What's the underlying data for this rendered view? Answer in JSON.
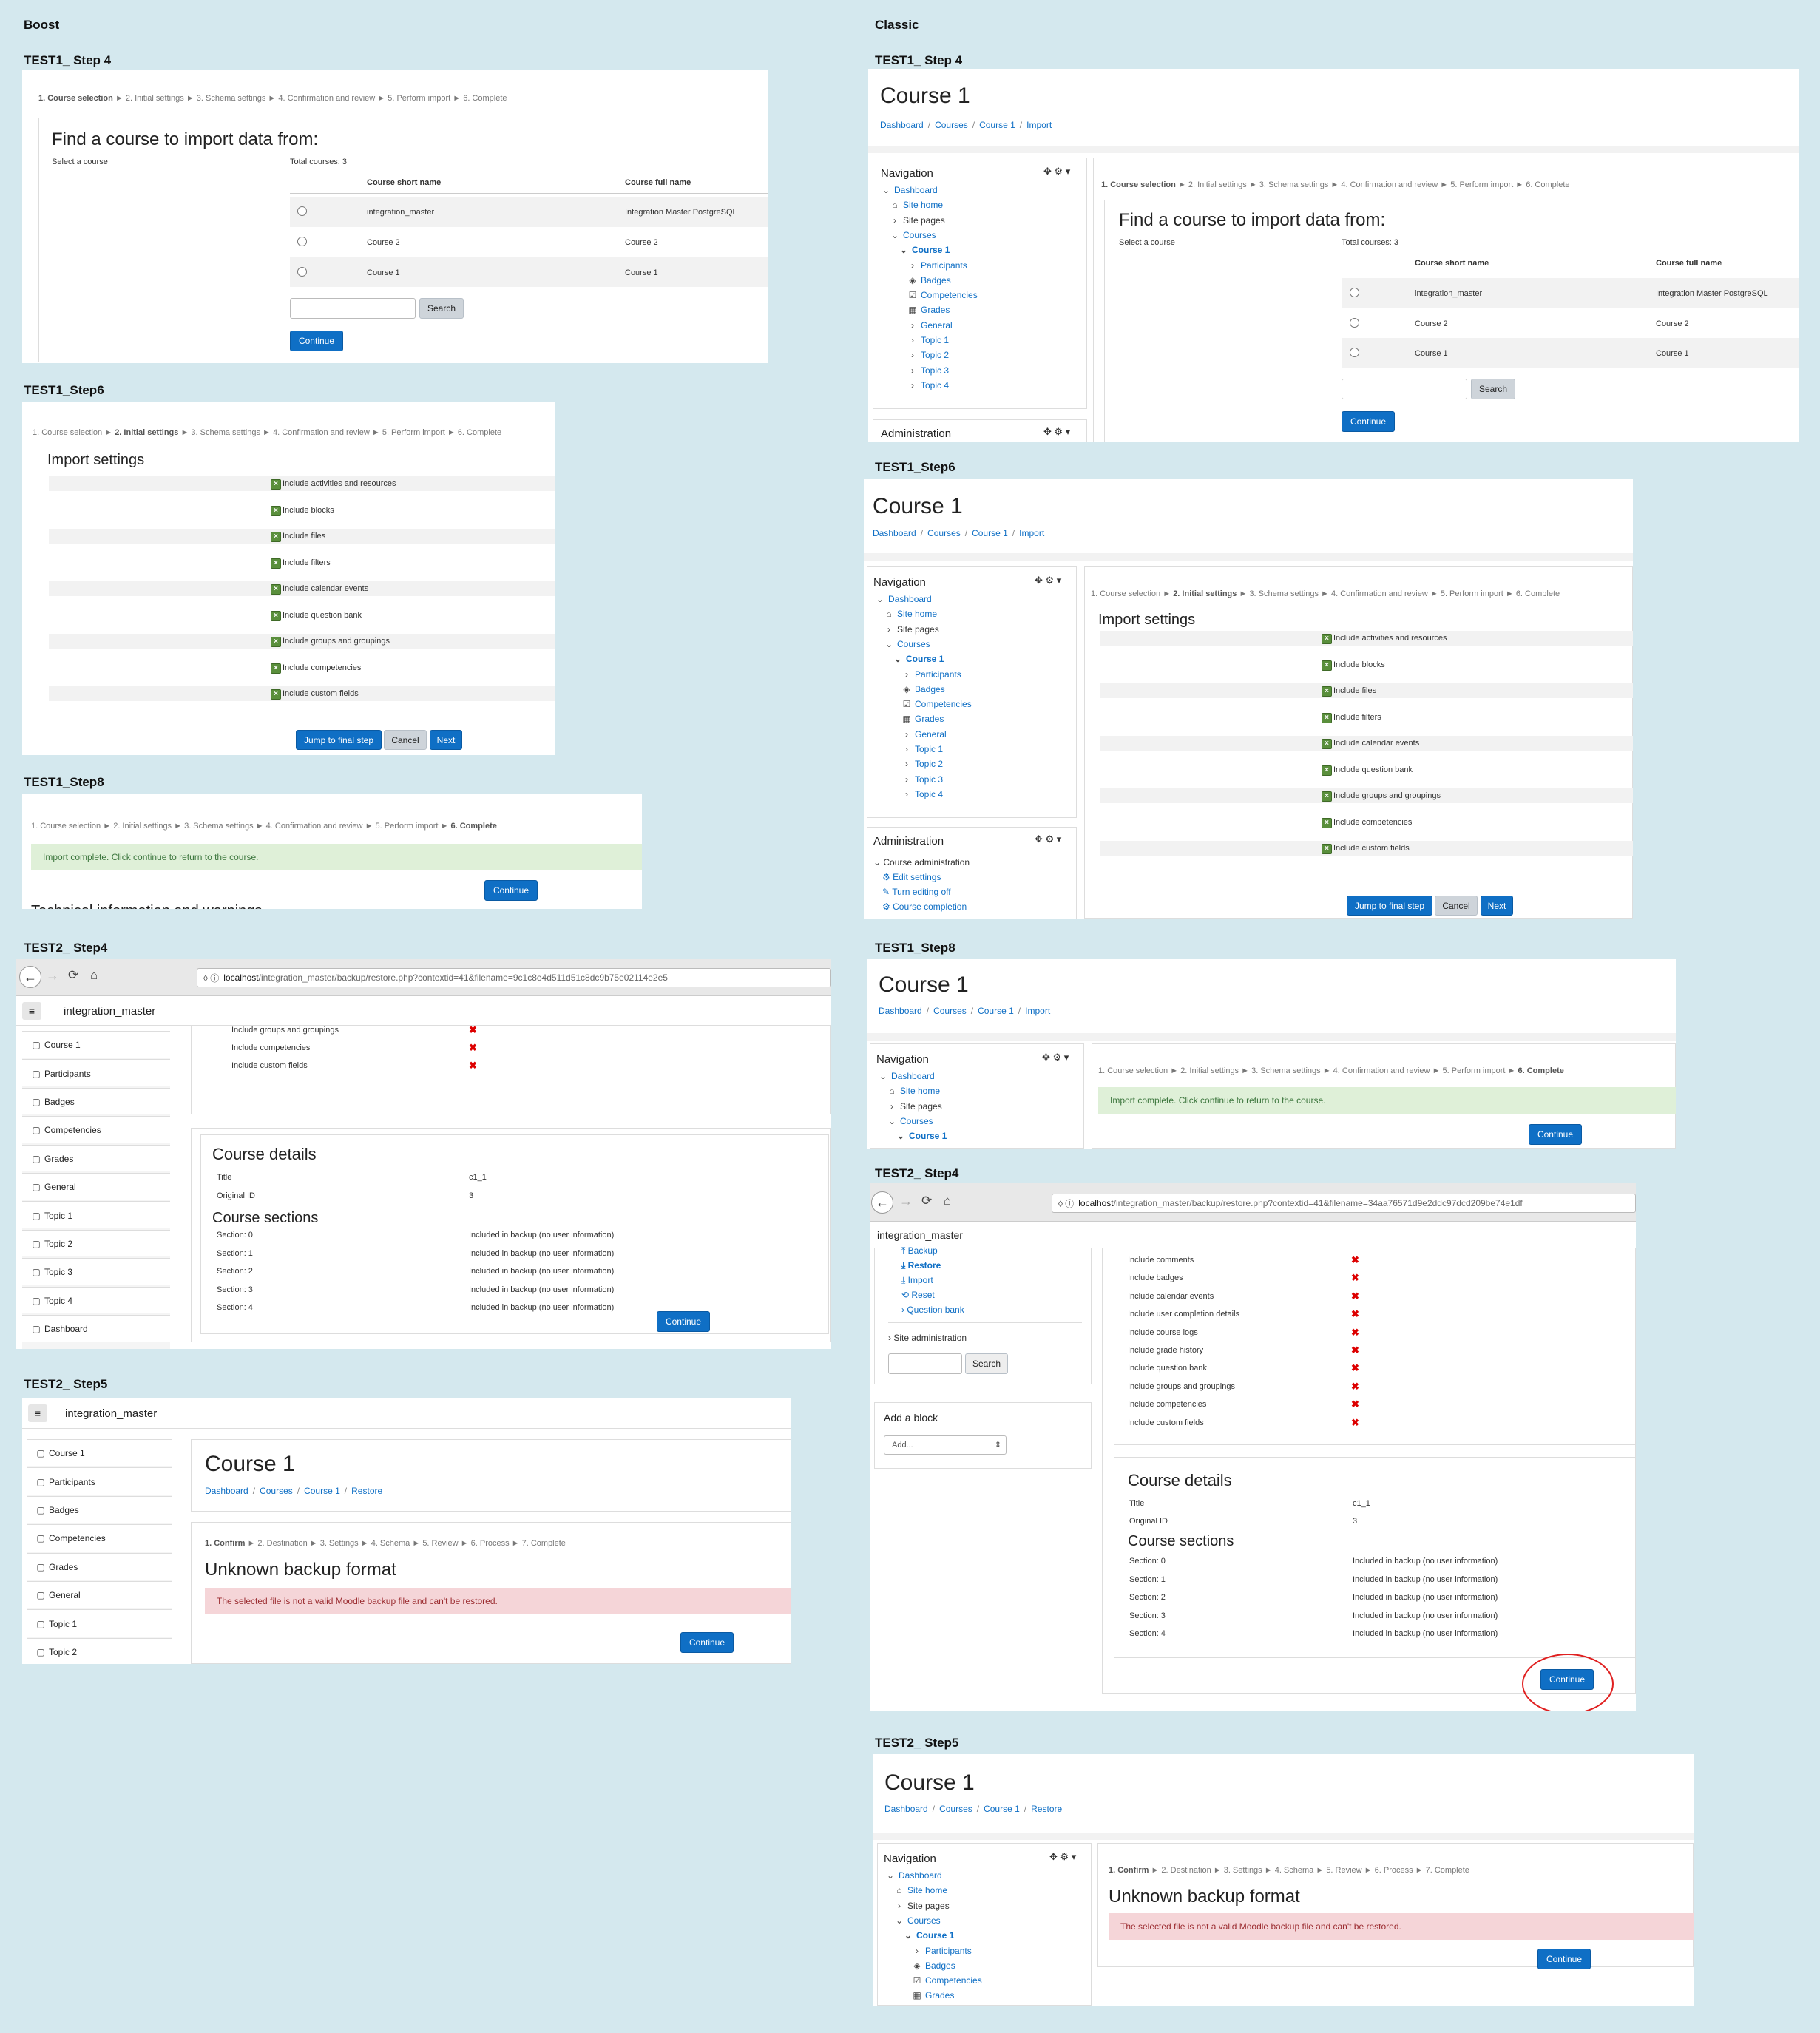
{
  "headers": {
    "boost": "Boost",
    "classic": "Classic"
  },
  "steps_import": {
    "s1": "1. Course selection",
    "s2": "2. Initial settings",
    "s3": "3. Schema settings",
    "s4": "4. Confirmation and review",
    "s5": "5. Perform import",
    "s6": "6. Complete",
    "arrow": "►"
  },
  "steps_restore": {
    "s1": "1. Confirm",
    "s2": "2. Destination",
    "s3": "3. Settings",
    "s4": "4. Schema",
    "s5": "5. Review",
    "s6": "6. Process",
    "s7": "7. Complete",
    "arrow": "►"
  },
  "find": {
    "heading": "Find a course to import data from:",
    "select_label": "Select a course",
    "total": "Total courses: 3",
    "col_short": "Course short name",
    "col_full": "Course full name",
    "rows": [
      {
        "short": "integration_master",
        "full": "Integration Master PostgreSQL"
      },
      {
        "short": "Course 2",
        "full": "Course 2"
      },
      {
        "short": "Course 1",
        "full": "Course 1"
      }
    ],
    "search_label": "Search",
    "continue_label": "Continue"
  },
  "import_settings": {
    "heading": "Import settings",
    "items": [
      "Include activities and resources",
      "Include blocks",
      "Include files",
      "Include filters",
      "Include calendar events",
      "Include question bank",
      "Include groups and groupings",
      "Include competencies",
      "Include custom fields"
    ],
    "jump": "Jump to final step",
    "cancel": "Cancel",
    "next": "Next"
  },
  "complete": {
    "message": "Import complete. Click continue to return to the course.",
    "continue_label": "Continue",
    "cutoff": "Technical information and warnings"
  },
  "labels": {
    "b1": "TEST1_ Step 4",
    "b2": "TEST1_Step6",
    "b3": "TEST1_Step8",
    "b4": "TEST2_ Step4",
    "b5": "TEST2_ Step5",
    "c1": "TEST1_ Step 4",
    "c2": "TEST1_Step6",
    "c3": "TEST1_Step8",
    "c4": "TEST2_ Step4",
    "c5": "TEST2_ Step5"
  },
  "course": {
    "title": "Course 1",
    "bc": [
      "Dashboard",
      "Courses",
      "Course 1"
    ],
    "bc_import": "Import",
    "bc_restore": "Restore"
  },
  "nav": {
    "title": "Navigation",
    "admin_title": "Administration",
    "items": [
      "Dashboard",
      "Site home",
      "Site pages",
      "Courses",
      "Course 1",
      "Participants",
      "Badges",
      "Competencies",
      "Grades",
      "General",
      "Topic 1",
      "Topic 2",
      "Topic 3",
      "Topic 4"
    ],
    "admin_items": [
      "Course administration",
      "Edit settings",
      "Turn editing off",
      "Course completion"
    ]
  },
  "browser": {
    "url1_host": "localhost",
    "url1_path": "/integration_master/backup/restore.php?contextid=41&filename=9c1c8e4d511d51c8dc9b75e02114e2e5",
    "url2_host": "localhost",
    "url2_path": "/integration_master/backup/restore.php?contextid=41&filename=34aa76571d9e2ddc97dcd209be74e1df",
    "sitename": "integration_master"
  },
  "restore": {
    "boost_top": [
      "Include groups and groupings",
      "Include competencies",
      "Include custom fields"
    ],
    "classic_top": [
      "Include comments",
      "Include badges",
      "Include calendar events",
      "Include user completion details",
      "Include course logs",
      "Include grade history",
      "Include question bank",
      "Include groups and groupings",
      "Include competencies",
      "Include custom fields"
    ],
    "details_heading": "Course details",
    "title_label": "Title",
    "title_value": "c1_1",
    "origid_label": "Original ID",
    "origid_value": "3",
    "sections_heading": "Course sections",
    "sections": [
      "Section: 0",
      "Section: 1",
      "Section: 2",
      "Section: 3",
      "Section: 4"
    ],
    "section_value": "Included in backup (no user information)",
    "continue_label": "Continue",
    "admin_left": [
      "Backup",
      "Restore",
      "Import",
      "Reset",
      "Question bank"
    ],
    "site_admin": "Site administration",
    "search": "Search",
    "add_block": "Add a block",
    "add_placeholder": "Add..."
  },
  "boost_side": [
    "Course 1",
    "Participants",
    "Badges",
    "Competencies",
    "Grades",
    "General",
    "Topic 1",
    "Topic 2",
    "Topic 3",
    "Topic 4",
    "Dashboard"
  ],
  "unknown": {
    "heading": "Unknown backup format",
    "message": "The selected file is not a valid Moodle backup file and can't be restored.",
    "continue_label": "Continue"
  }
}
